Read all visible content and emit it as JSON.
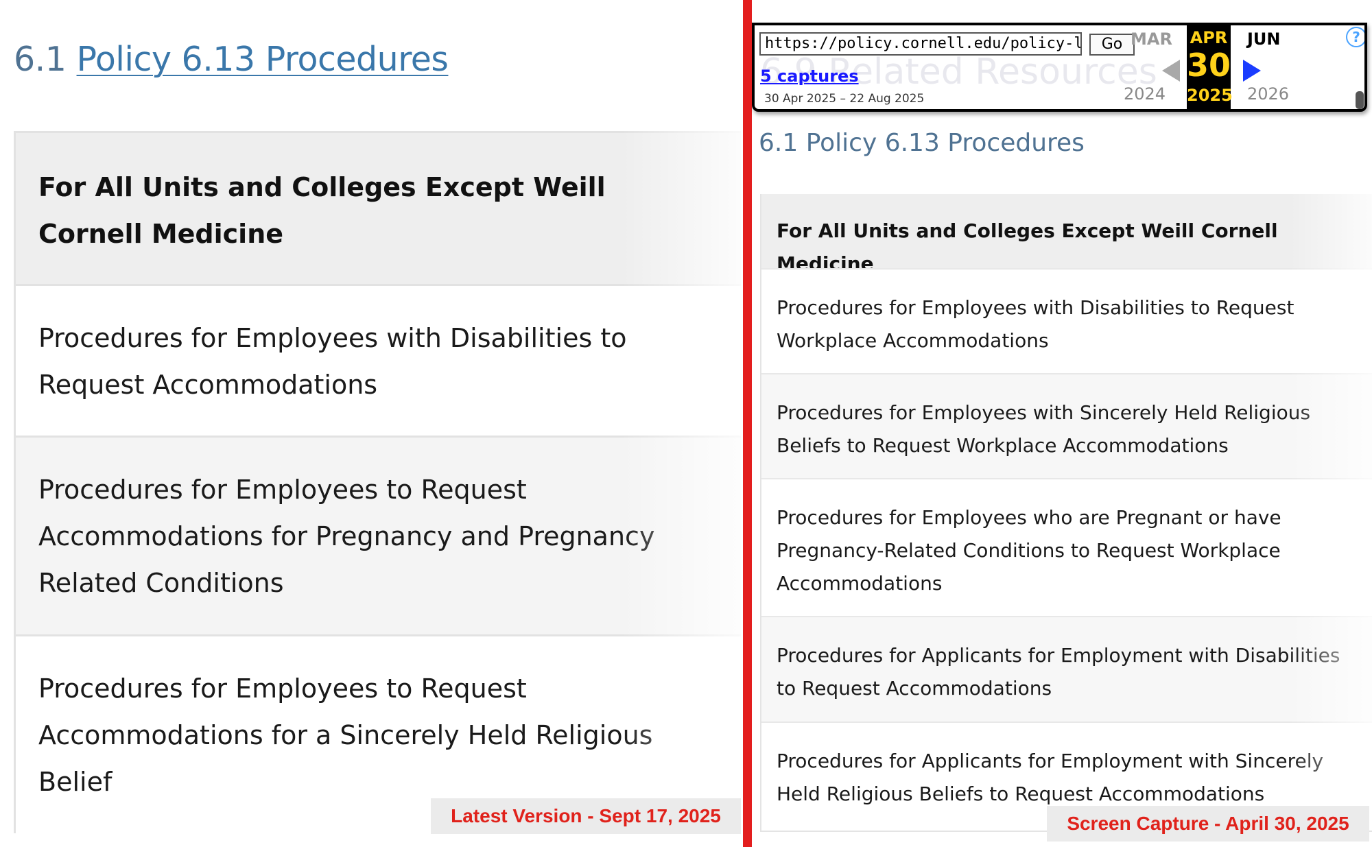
{
  "left": {
    "heading_number": "6.1",
    "heading_link": "Policy 6.13 Procedures",
    "accordion_header": "For All Units and Colleges Except Weill Cornell Medicine",
    "items": [
      "Procedures for Employees with Disabilities to Request Accommodations",
      "Procedures for Employees to Request Accommodations for Pregnancy and Pregnancy Related Conditions",
      "Procedures for Employees to Request Accommodations for a Sincerely Held Religious Belief"
    ],
    "caption": "Latest Version - Sept 17, 2025"
  },
  "wayback": {
    "url": "https://policy.cornell.edu/policy-library",
    "go_label": "Go",
    "captures_link": "5 captures",
    "capture_range": "30 Apr 2025 – 22 Aug 2025",
    "prev_month": "MAR",
    "current_month": "APR",
    "next_month": "JUN",
    "current_day": "30",
    "prev_year": "2024",
    "current_year": "2025",
    "next_year": "2026",
    "help_glyph": "?",
    "ghost_text": "6.9 Related Resources",
    "colors": {
      "highlight_bg": "#000000",
      "highlight_text": "#ffd21a",
      "next_arrow": "#1a3cff"
    }
  },
  "right": {
    "heading": "6.1 Policy 6.13 Procedures",
    "accordion_header": "For All Units and Colleges Except Weill Cornell Medicine",
    "items": [
      "Procedures for Employees with Disabilities to Request Workplace Accommodations",
      "Procedures for Employees with Sincerely Held Religious Beliefs to Request Workplace Accommodations",
      "Procedures for Employees who are Pregnant or have Pregnancy-Related Conditions to Request Workplace Accommodations",
      "Procedures for Applicants for Employment with Disabilities to Request Accommodations",
      "Procedures for Applicants for Employment with Sincerely Held Religious Beliefs to Request Accommodations"
    ],
    "caption": "Screen Capture - April 30, 2025"
  },
  "colors": {
    "divider": "#e31e1e",
    "caption_text": "#e0221b",
    "link": "#3a77aa"
  }
}
